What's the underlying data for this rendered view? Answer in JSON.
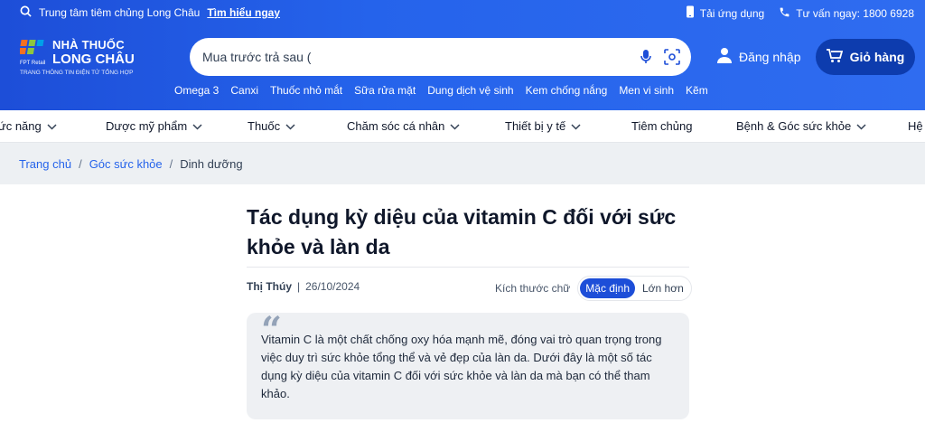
{
  "topbar": {
    "promo_text": "Trung tâm tiêm chủng Long Châu",
    "promo_link": "Tìm hiểu ngay",
    "app_download": "Tải ứng dụng",
    "hotline": "Tư vấn ngay: 1800 6928"
  },
  "logo": {
    "fpt": "FPT Retail",
    "line1": "NHÀ THUỐC",
    "line2": "LONG CHÂU",
    "tagline": "TRANG THÔNG TIN ĐIỆN TỬ TỔNG HỢP"
  },
  "search": {
    "value": "Mua trước trả sau ("
  },
  "account": {
    "login": "Đăng nhập",
    "cart": "Giỏ hàng"
  },
  "keywords": [
    "Omega 3",
    "Canxi",
    "Thuốc nhỏ mắt",
    "Sữa rửa mặt",
    "Dung dịch vệ sinh",
    "Kem chống nắng",
    "Men vi sinh",
    "Kẽm"
  ],
  "nav": [
    "ức năng",
    "Dược mỹ phẩm",
    "Thuốc",
    "Chăm sóc cá nhân",
    "Thiết bị y tế",
    "Tiêm chủng",
    "Bệnh & Góc sức khỏe",
    "Hệ"
  ],
  "breadcrumb": {
    "home": "Trang chủ",
    "section": "Góc sức khỏe",
    "current": "Dinh dưỡng",
    "sep": "/"
  },
  "article": {
    "title": "Tác dụng kỳ diệu của vitamin C đối với sức khỏe và làn da",
    "author": "Thị Thúy",
    "date": "26/10/2024",
    "font_size_label": "Kích thước chữ",
    "font_default": "Mặc định",
    "font_large": "Lớn hơn",
    "quote": "Vitamin C là một chất chống oxy hóa mạnh mẽ, đóng vai trò quan trọng trong việc duy trì sức khỏe tổng thể và vẻ đẹp của làn da. Dưới đây là một số tác dụng kỳ diệu của vitamin C đối với sức khỏe và làn da mà bạn có thể tham khảo."
  },
  "colors": {
    "brand": "#1d4ed8",
    "cart_bg": "#0d3cae",
    "breadcrumb_bg": "#edf0f3"
  }
}
